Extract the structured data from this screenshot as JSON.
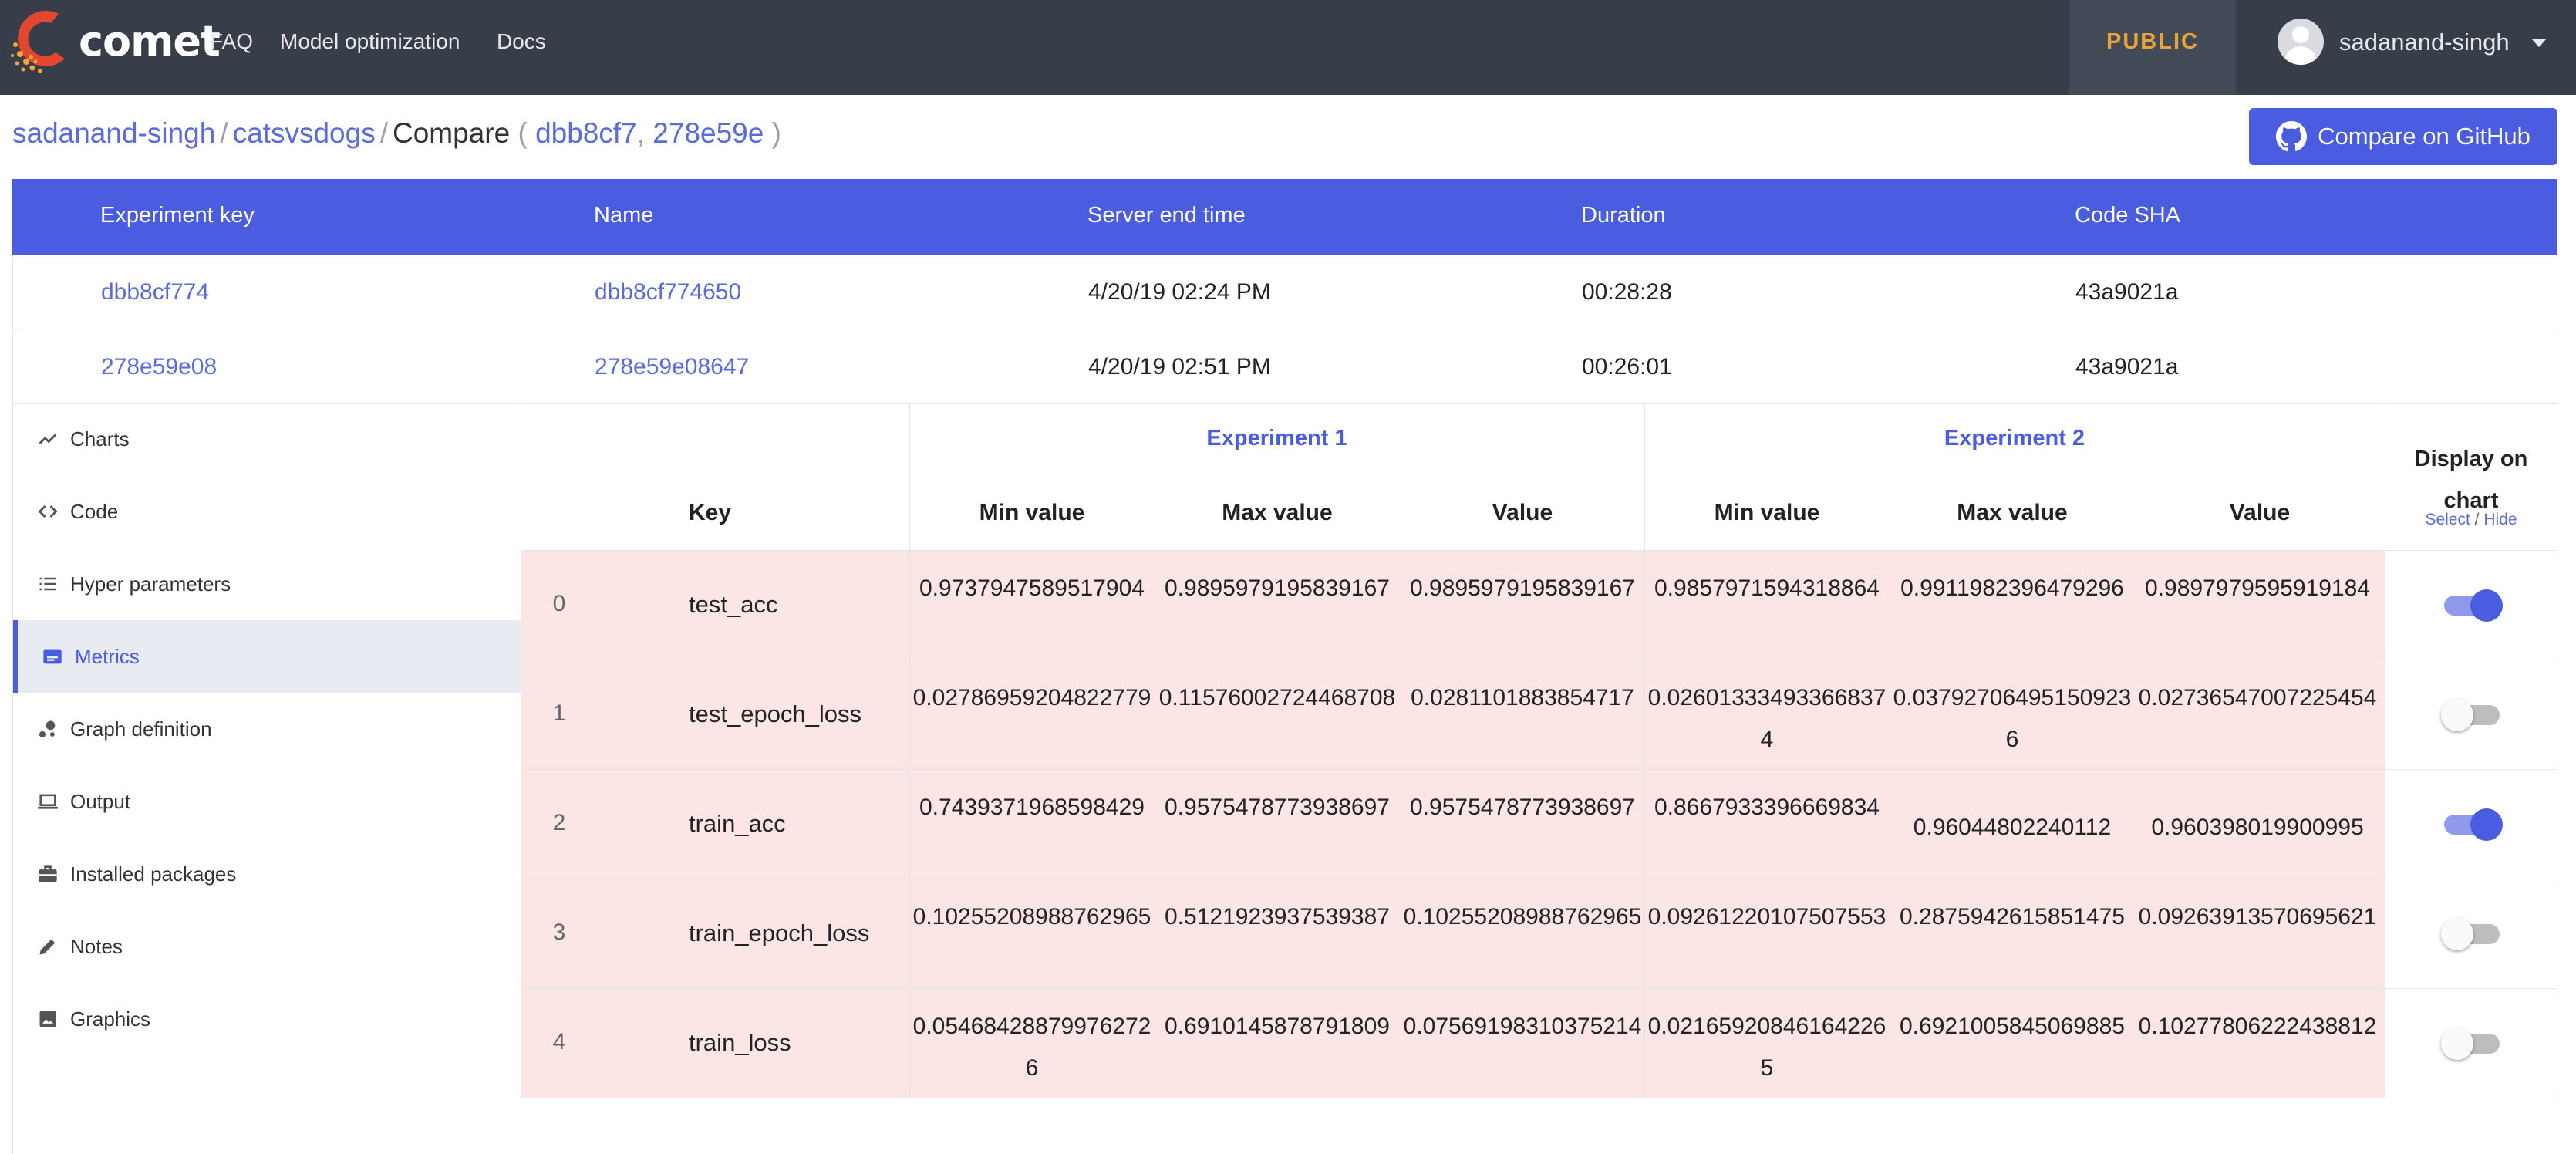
{
  "nav": {
    "brand": "comet",
    "links": [
      "FAQ",
      "Model optimization",
      "Docs"
    ],
    "visibility": "PUBLIC",
    "user": "sadanand-singh"
  },
  "breadcrumb": {
    "workspace": "sadanand-singh",
    "project": "catsvsdogs",
    "page": "Compare",
    "open_paren": "(",
    "exp1": "dbb8cf7",
    "comma": ",",
    "exp2": "278e59e",
    "close_paren": ")"
  },
  "github_button": "Compare on GitHub",
  "experiments": {
    "headers": [
      "Experiment key",
      "Name",
      "Server end time",
      "Duration",
      "Code SHA"
    ],
    "rows": [
      {
        "key": "dbb8cf774",
        "name": "dbb8cf774650",
        "end_time": "4/20/19 02:24 PM",
        "duration": "00:28:28",
        "sha": "43a9021a"
      },
      {
        "key": "278e59e08",
        "name": "278e59e08647",
        "end_time": "4/20/19 02:51 PM",
        "duration": "00:26:01",
        "sha": "43a9021a"
      }
    ]
  },
  "sidebar": {
    "items": [
      {
        "label": "Charts",
        "icon": "line-chart-icon"
      },
      {
        "label": "Code",
        "icon": "code-icon"
      },
      {
        "label": "Hyper parameters",
        "icon": "list-icon"
      },
      {
        "label": "Metrics",
        "icon": "metrics-icon",
        "active": true
      },
      {
        "label": "Graph definition",
        "icon": "graph-icon"
      },
      {
        "label": "Output",
        "icon": "laptop-icon"
      },
      {
        "label": "Installed packages",
        "icon": "briefcase-icon"
      },
      {
        "label": "Notes",
        "icon": "pencil-icon"
      },
      {
        "label": "Graphics",
        "icon": "image-icon"
      }
    ]
  },
  "metrics": {
    "group1": "Experiment 1",
    "group2": "Experiment 2",
    "key_header": "Key",
    "min_header": "Min value",
    "max_header": "Max value",
    "value_header": "Value",
    "display_title": "Display on chart",
    "select_label": "Select",
    "slash": "/",
    "hide_label": "Hide",
    "rows": [
      {
        "index": "0",
        "key": "test_acc",
        "e1_min": "0.9737947589517904",
        "e1_max": "0.9895979195839167",
        "e1_val": "0.9895979195839167",
        "e2_min": "0.9857971594318864",
        "e2_max": "0.9911982396479296",
        "e2_val": "0.9897979595919184",
        "display": true
      },
      {
        "index": "1",
        "key": "test_epoch_loss",
        "e1_min": "0.02786959204822779",
        "e1_max": "0.11576002724468708",
        "e1_val": "0.0281101883854717",
        "e2_min": "0.026013334933668374",
        "e2_max": "0.037927064951509236",
        "e2_val": "0.02736547007225454",
        "display": false
      },
      {
        "index": "2",
        "key": "train_acc",
        "e1_min": "0.7439371968598429",
        "e1_max": "0.9575478773938697",
        "e1_val": "0.9575478773938697",
        "e2_min": "0.8667933396669834",
        "e2_max": "0.96044802240112",
        "e2_val": "0.960398019900995",
        "display": true
      },
      {
        "index": "3",
        "key": "train_epoch_loss",
        "e1_min": "0.10255208988762965",
        "e1_max": "0.5121923937539387",
        "e1_val": "0.10255208988762965",
        "e2_min": "0.09261220107507553",
        "e2_max": "0.2875942615851475",
        "e2_val": "0.09263913570695621",
        "display": false
      },
      {
        "index": "4",
        "key": "train_loss",
        "e1_min": "0.054684288799762726",
        "e1_max": "0.6910145878791809",
        "e1_val": "0.07569198310375214",
        "e2_min": "0.021659208461642265",
        "e2_max": "0.6921005845069885",
        "e2_val": "0.10277806222438812",
        "display": false
      }
    ]
  },
  "colors": {
    "topbar": "#373d49",
    "accent": "#4a5ce0",
    "public": "#e8a33a",
    "row_highlight": "#fbe5e5"
  }
}
